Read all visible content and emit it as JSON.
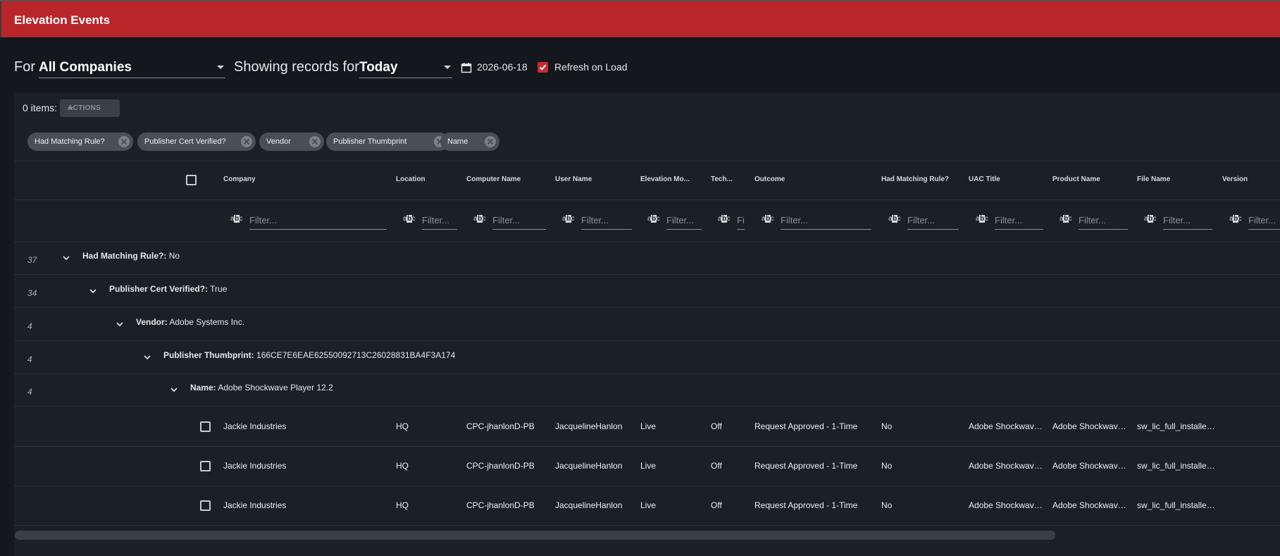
{
  "app": {
    "title": "Elevation Events"
  },
  "filters": {
    "for_label": "For",
    "company_value": "All Companies",
    "showing_label": "Showing records for",
    "period_value": "Today",
    "date": "2026-06-18",
    "refresh_label": "Refresh on Load",
    "refresh_checked": true
  },
  "toolbar": {
    "items_count": "0 items:",
    "actions_label": "ACTIONS"
  },
  "group_chips": [
    "Had Matching Rule?",
    "Publisher Cert Verified?",
    "Vendor",
    "Publisher Thumbprint",
    "Name"
  ],
  "columns": [
    "Company",
    "Location",
    "Computer Name",
    "User Name",
    "Elevation Mo...",
    "Tech...",
    "Outcome",
    "Had Matching Rule?",
    "UAC Title",
    "Product Name",
    "File Name",
    "Version"
  ],
  "filter_placeholder": {
    "full": "Filter...",
    "short": "Fi"
  },
  "groups": [
    {
      "count": "37",
      "field": "Had Matching Rule?:",
      "value": "No"
    },
    {
      "count": "34",
      "field": "Publisher Cert Verified?:",
      "value": "True"
    },
    {
      "count": "4",
      "field": "Vendor:",
      "value": "Adobe Systems Inc."
    },
    {
      "count": "4",
      "field": "Publisher Thumbprint:",
      "value": "166CE7E6EAE62550092713C26028831BA4F3A174"
    },
    {
      "count": "4",
      "field": "Name:",
      "value": "Adobe Shockwave Player 12.2"
    }
  ],
  "rows": [
    {
      "company": "Jackie Industries",
      "location": "HQ",
      "computer": "CPC-jhanlonD-PB",
      "user": "JacquelineHanlon",
      "mode": "Live",
      "tech": "Off",
      "outcome": "Request Approved - 1-Time",
      "matching": "No",
      "uac": "Adobe Shockwave ...",
      "product": "Adobe Shockwave ...",
      "file": "sw_lic_full_installer..."
    },
    {
      "company": "Jackie Industries",
      "location": "HQ",
      "computer": "CPC-jhanlonD-PB",
      "user": "JacquelineHanlon",
      "mode": "Live",
      "tech": "Off",
      "outcome": "Request Approved - 1-Time",
      "matching": "No",
      "uac": "Adobe Shockwave ...",
      "product": "Adobe Shockwave ...",
      "file": "sw_lic_full_installer..."
    },
    {
      "company": "Jackie Industries",
      "location": "HQ",
      "computer": "CPC-jhanlonD-PB",
      "user": "JacquelineHanlon",
      "mode": "Live",
      "tech": "Off",
      "outcome": "Request Approved - 1-Time",
      "matching": "No",
      "uac": "Adobe Shockwave ...",
      "product": "Adobe Shockwave ...",
      "file": "sw_lic_full_installer..."
    }
  ],
  "icons": {
    "calendar": "calendar-icon",
    "checkbox_checked": "checkbox-checked-icon",
    "chevron": "chevron-down-icon",
    "chip_remove": "close-circle-icon",
    "text_filter": "abc-filter-icon"
  },
  "colors": {
    "accent": "#b8262a",
    "background": "#14171c",
    "panel": "#1b1f26",
    "chip": "#4a4e55"
  }
}
